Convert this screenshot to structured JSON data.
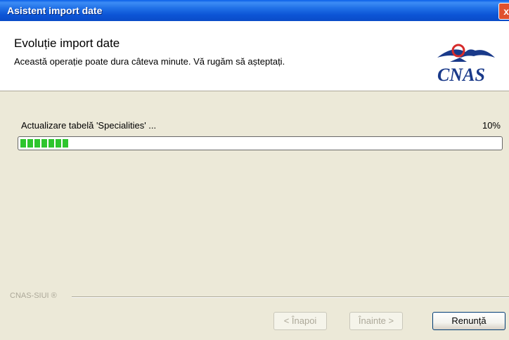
{
  "window": {
    "title": "Asistent import date",
    "close_glyph": "x"
  },
  "header": {
    "title": "Evoluție import date",
    "subtitle": "Această operație poate dura câteva minute. Vă rugăm să așteptați.",
    "logo_text": "CNAS",
    "logo_icon": "cnas-eagle-logo"
  },
  "progress": {
    "status_label": "Actualizare tabelă 'Specialities' ...",
    "percent_label": "10%",
    "value": 0.1,
    "bar_color": "#2ec52e"
  },
  "footer": {
    "brand": "CNAS-SIUI ®"
  },
  "buttons": {
    "back_label": "< Înapoi",
    "next_label": "Înainte >",
    "cancel_label": "Renunță"
  },
  "colors": {
    "titlebar": "#0a55d6",
    "logo_red": "#d62b2b",
    "logo_blue": "#1a3a8a"
  }
}
